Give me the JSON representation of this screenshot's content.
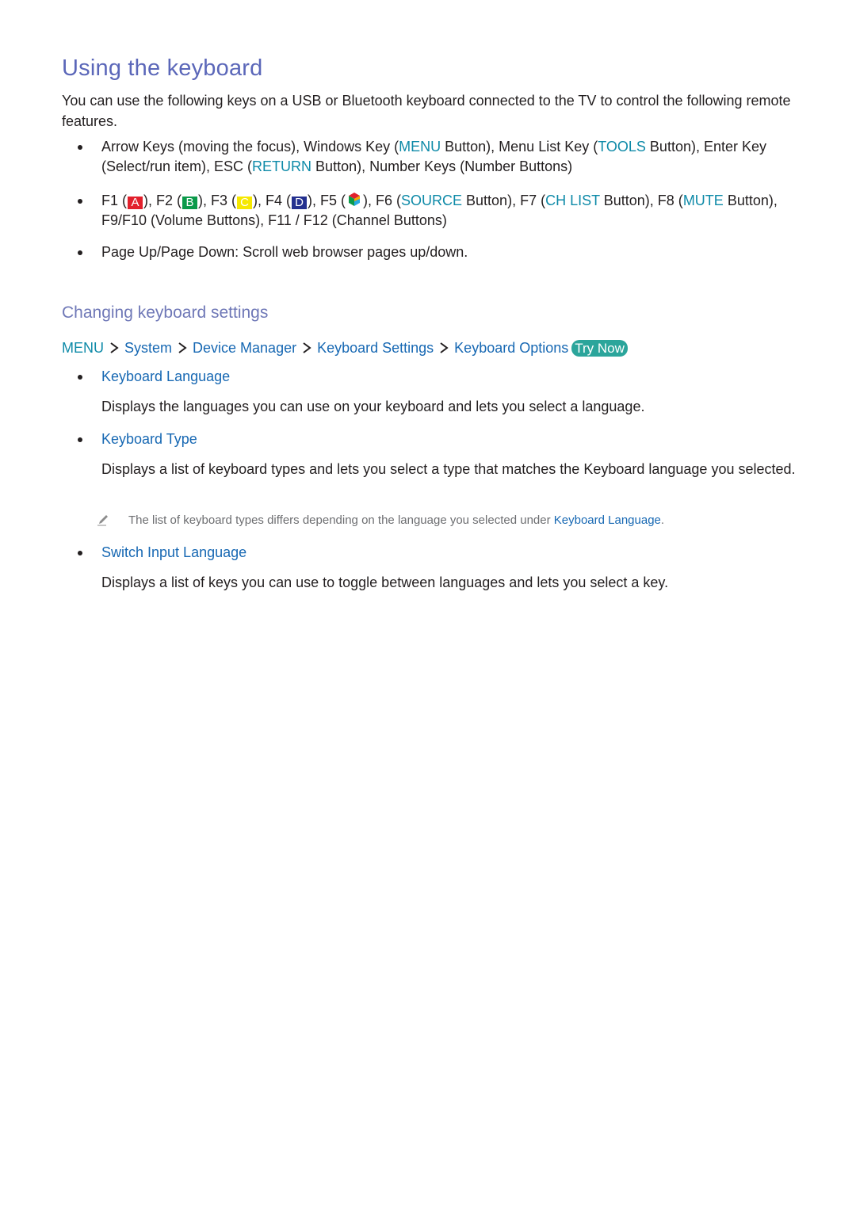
{
  "colors": {
    "heading": "#5b67b9",
    "subheading": "#6f78b7",
    "keyword": "#0e8aa8",
    "link": "#1768b3",
    "try_now_bg": "#2ba59b",
    "note_text": "#6d6e71"
  },
  "title": "Using the keyboard",
  "intro": "You can use the following keys on a USB or Bluetooth keyboard connected to the TV to control the following remote features.",
  "bullets": {
    "b1": {
      "t1": "Arrow Keys (moving the focus), Windows Key (",
      "k1": "MENU",
      "t2": " Button), Menu List Key (",
      "k2": "TOOLS",
      "t3": " Button), Enter Key (Select/run item), ESC (",
      "k3": "RETURN",
      "t4": " Button), Number Keys (Number Buttons)"
    },
    "b2": {
      "f1": "F1 (",
      "key_a": "A",
      "f2": "), F2 (",
      "key_b": "B",
      "f3": "), F3 (",
      "key_c": "C",
      "f4": "), F4 (",
      "key_d": "D",
      "f5": "), F5 (",
      "source_icon": "smart-hub-icon",
      "f6": "), F6 (",
      "k_source": "SOURCE",
      "f7": " Button), F7 (",
      "k_chlist": "CH LIST",
      "f8": " Button), F8 (",
      "k_mute": "MUTE",
      "rest": " Button), F9/F10 (Volume Buttons), F11 / F12 (Channel Buttons)"
    },
    "b3": "Page Up/Page Down: Scroll web browser pages up/down."
  },
  "section": {
    "title": "Changing keyboard settings",
    "path": [
      "MENU",
      "System",
      "Device Manager",
      "Keyboard Settings",
      "Keyboard Options"
    ],
    "try_now": "Try Now",
    "items": [
      {
        "title": "Keyboard Language",
        "desc": "Displays the languages you can use on your keyboard and lets you select a language."
      },
      {
        "title": "Keyboard Type",
        "desc": "Displays a list of keyboard types and lets you select a type that matches the Keyboard language you selected.",
        "note_text": "The list of keyboard types differs depending on the language you selected under ",
        "note_link": "Keyboard Language",
        "note_end": "."
      },
      {
        "title": "Switch Input Language",
        "desc": "Displays a list of keys you can use to toggle between languages and lets you select a key."
      }
    ]
  }
}
